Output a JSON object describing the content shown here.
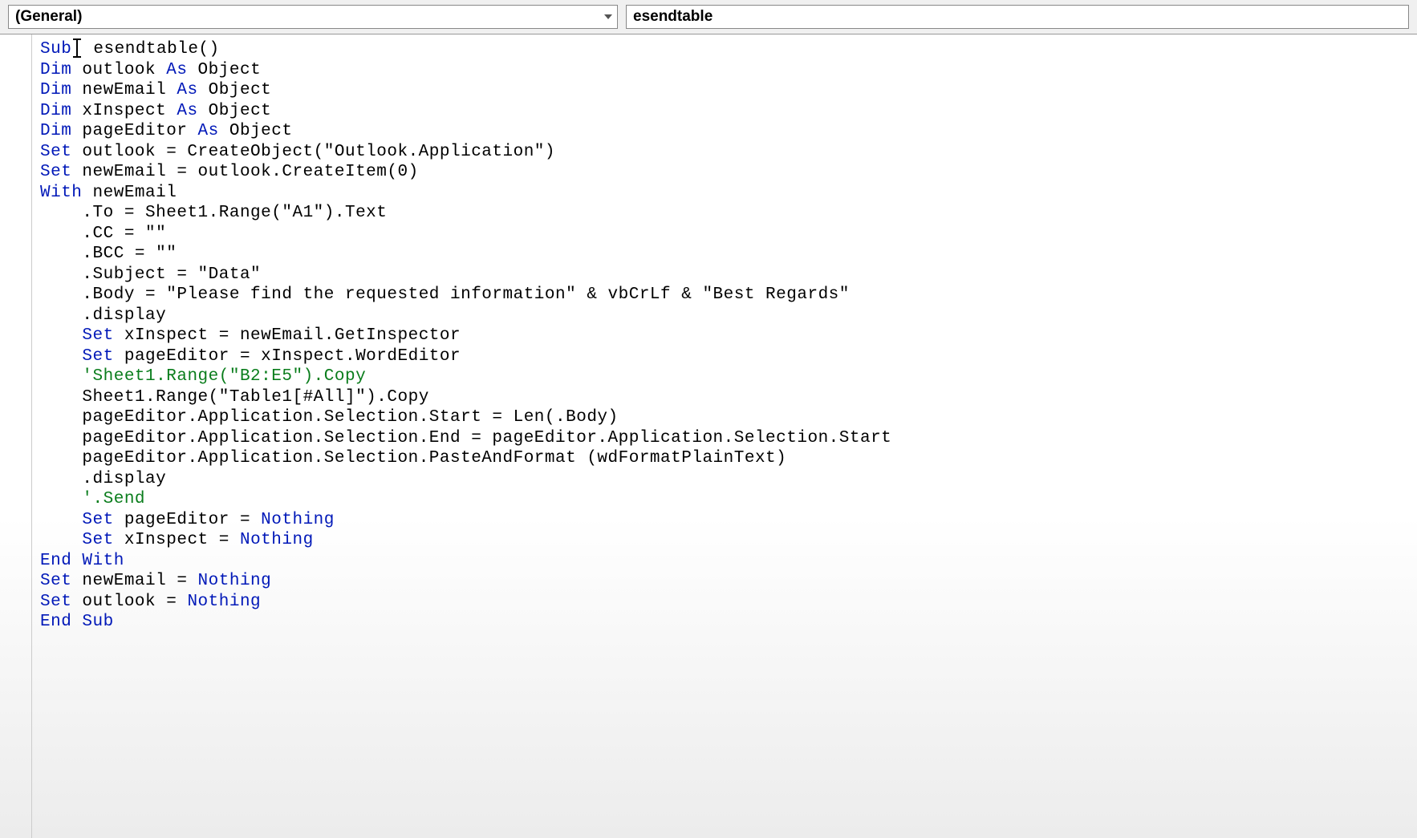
{
  "dropdowns": {
    "object": "(General)",
    "procedure": "esendtable"
  },
  "code": {
    "lines": [
      {
        "indent": 0,
        "tokens": [
          {
            "t": "kw",
            "v": "Sub"
          },
          {
            "t": "txt",
            "v": " esendtable()"
          }
        ]
      },
      {
        "indent": 0,
        "tokens": [
          {
            "t": "kw",
            "v": "Dim"
          },
          {
            "t": "txt",
            "v": " outlook "
          },
          {
            "t": "kw",
            "v": "As"
          },
          {
            "t": "txt",
            "v": " Object"
          }
        ]
      },
      {
        "indent": 0,
        "tokens": [
          {
            "t": "kw",
            "v": "Dim"
          },
          {
            "t": "txt",
            "v": " newEmail "
          },
          {
            "t": "kw",
            "v": "As"
          },
          {
            "t": "txt",
            "v": " Object"
          }
        ]
      },
      {
        "indent": 0,
        "tokens": [
          {
            "t": "kw",
            "v": "Dim"
          },
          {
            "t": "txt",
            "v": " xInspect "
          },
          {
            "t": "kw",
            "v": "As"
          },
          {
            "t": "txt",
            "v": " Object"
          }
        ]
      },
      {
        "indent": 0,
        "tokens": [
          {
            "t": "kw",
            "v": "Dim"
          },
          {
            "t": "txt",
            "v": " pageEditor "
          },
          {
            "t": "kw",
            "v": "As"
          },
          {
            "t": "txt",
            "v": " Object"
          }
        ]
      },
      {
        "indent": 0,
        "tokens": [
          {
            "t": "kw",
            "v": "Set"
          },
          {
            "t": "txt",
            "v": " outlook = CreateObject(\"Outlook.Application\")"
          }
        ]
      },
      {
        "indent": 0,
        "tokens": [
          {
            "t": "kw",
            "v": "Set"
          },
          {
            "t": "txt",
            "v": " newEmail = outlook.CreateItem(0)"
          }
        ]
      },
      {
        "indent": 0,
        "tokens": [
          {
            "t": "kw",
            "v": "With"
          },
          {
            "t": "txt",
            "v": " newEmail"
          }
        ]
      },
      {
        "indent": 1,
        "tokens": [
          {
            "t": "txt",
            "v": ".To = Sheet1.Range(\"A1\").Text"
          }
        ]
      },
      {
        "indent": 1,
        "tokens": [
          {
            "t": "txt",
            "v": ".CC = \"\""
          }
        ]
      },
      {
        "indent": 1,
        "tokens": [
          {
            "t": "txt",
            "v": ".BCC = \"\""
          }
        ]
      },
      {
        "indent": 1,
        "tokens": [
          {
            "t": "txt",
            "v": ".Subject = \"Data\""
          }
        ]
      },
      {
        "indent": 1,
        "tokens": [
          {
            "t": "txt",
            "v": ".Body = \"Please find the requested information\" & vbCrLf & \"Best Regards\""
          }
        ]
      },
      {
        "indent": 1,
        "tokens": [
          {
            "t": "txt",
            "v": ".display"
          }
        ]
      },
      {
        "indent": 1,
        "tokens": [
          {
            "t": "kw",
            "v": "Set"
          },
          {
            "t": "txt",
            "v": " xInspect = newEmail.GetInspector"
          }
        ]
      },
      {
        "indent": 1,
        "tokens": [
          {
            "t": "kw",
            "v": "Set"
          },
          {
            "t": "txt",
            "v": " pageEditor = xInspect.WordEditor"
          }
        ]
      },
      {
        "indent": 1,
        "tokens": [
          {
            "t": "cm",
            "v": "'Sheet1.Range(\"B2:E5\").Copy"
          }
        ]
      },
      {
        "indent": 1,
        "tokens": [
          {
            "t": "txt",
            "v": "Sheet1.Range(\"Table1[#All]\").Copy"
          }
        ]
      },
      {
        "indent": 1,
        "tokens": [
          {
            "t": "txt",
            "v": "pageEditor.Application.Selection.Start = Len(.Body)"
          }
        ]
      },
      {
        "indent": 1,
        "tokens": [
          {
            "t": "txt",
            "v": "pageEditor.Application.Selection.End = pageEditor.Application.Selection.Start"
          }
        ]
      },
      {
        "indent": 1,
        "tokens": [
          {
            "t": "txt",
            "v": "pageEditor.Application.Selection.PasteAndFormat (wdFormatPlainText)"
          }
        ]
      },
      {
        "indent": 1,
        "tokens": [
          {
            "t": "txt",
            "v": ".display"
          }
        ]
      },
      {
        "indent": 1,
        "tokens": [
          {
            "t": "cm",
            "v": "'.Send"
          }
        ]
      },
      {
        "indent": 1,
        "tokens": [
          {
            "t": "kw",
            "v": "Set"
          },
          {
            "t": "txt",
            "v": " pageEditor = "
          },
          {
            "t": "kw",
            "v": "Nothing"
          }
        ]
      },
      {
        "indent": 1,
        "tokens": [
          {
            "t": "kw",
            "v": "Set"
          },
          {
            "t": "txt",
            "v": " xInspect = "
          },
          {
            "t": "kw",
            "v": "Nothing"
          }
        ]
      },
      {
        "indent": 0,
        "tokens": [
          {
            "t": "kw",
            "v": "End With"
          }
        ]
      },
      {
        "indent": 0,
        "tokens": [
          {
            "t": "kw",
            "v": "Set"
          },
          {
            "t": "txt",
            "v": " newEmail = "
          },
          {
            "t": "kw",
            "v": "Nothing"
          }
        ]
      },
      {
        "indent": 0,
        "tokens": [
          {
            "t": "kw",
            "v": "Set"
          },
          {
            "t": "txt",
            "v": " outlook = "
          },
          {
            "t": "kw",
            "v": "Nothing"
          }
        ]
      },
      {
        "indent": 0,
        "tokens": [
          {
            "t": "kw",
            "v": "End Sub"
          }
        ]
      }
    ]
  },
  "cursor": {
    "line": 0,
    "after_token": 0
  }
}
